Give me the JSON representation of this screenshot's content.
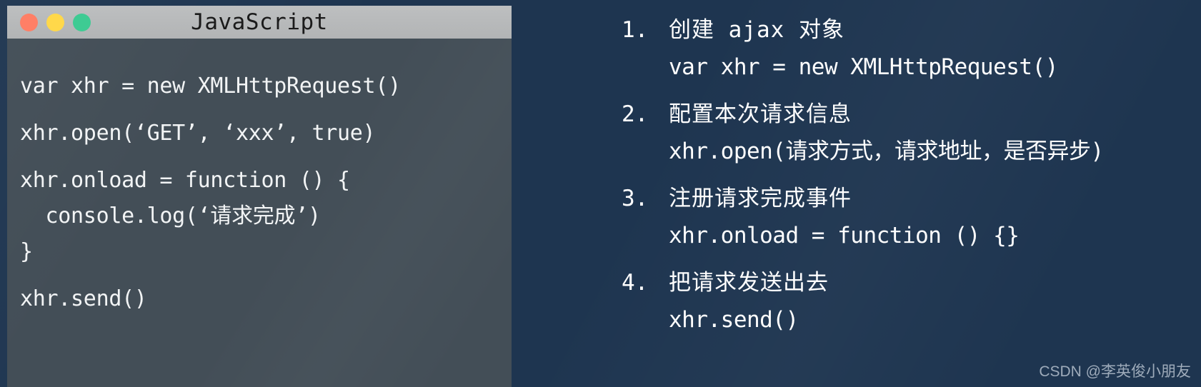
{
  "window": {
    "title": "JavaScript",
    "traffic_lights": [
      {
        "name": "close",
        "color": "#ff7f66"
      },
      {
        "name": "minimize",
        "color": "#ffd84a"
      },
      {
        "name": "maximize",
        "color": "#3ecb93"
      }
    ],
    "code_lines": [
      "var xhr = new XMLHttpRequest()",
      "xhr.open(‘GET’, ‘xxx’, true)",
      "xhr.onload = function () {",
      "  console.log(‘请求完成’)",
      "}",
      "xhr.send()"
    ]
  },
  "steps": [
    {
      "number": "1.",
      "title": "创建 ajax 对象",
      "code": "var xhr = new XMLHttpRequest()"
    },
    {
      "number": "2.",
      "title": "配置本次请求信息",
      "code": "xhr.open(请求方式，请求地址，是否异步)"
    },
    {
      "number": "3.",
      "title": "注册请求完成事件",
      "code": "xhr.onload = function () {}"
    },
    {
      "number": "4.",
      "title": "把请求发送出去",
      "code": "xhr.send()"
    }
  ],
  "watermark": "CSDN @李英俊小朋友",
  "colors": {
    "page_background": "#1e3550",
    "code_background": "#434e57",
    "title_bar": "#b9bbbc",
    "code_text": "#f2f4f5",
    "step_text": "#ffffff",
    "watermark_text": "#a9b6c4"
  }
}
